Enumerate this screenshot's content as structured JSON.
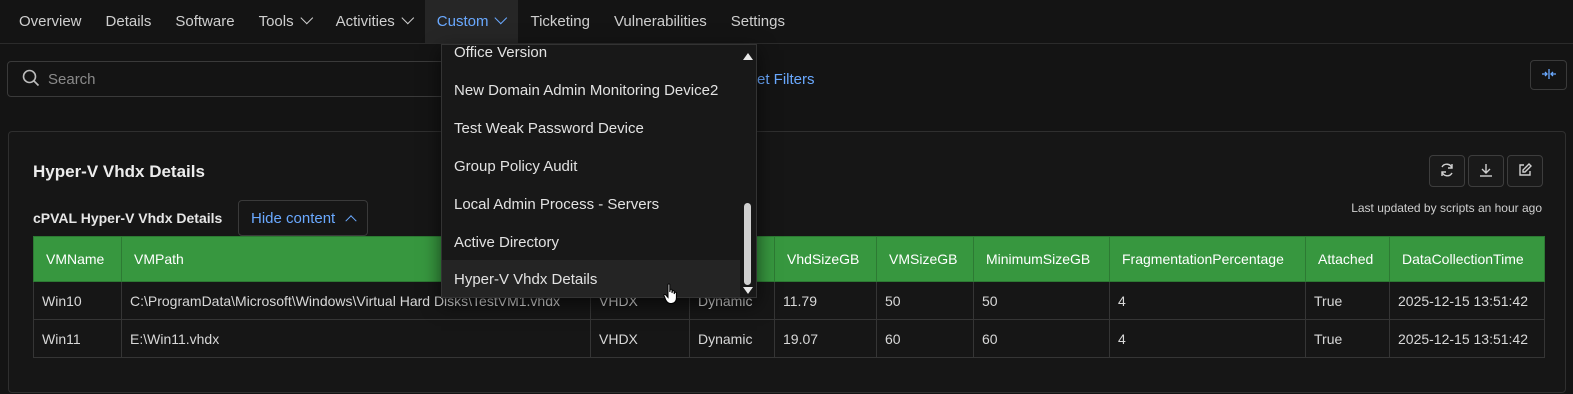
{
  "nav": {
    "items": [
      {
        "label": "Overview",
        "has_menu": false,
        "active": false
      },
      {
        "label": "Details",
        "has_menu": false,
        "active": false
      },
      {
        "label": "Software",
        "has_menu": false,
        "active": false
      },
      {
        "label": "Tools",
        "has_menu": true,
        "active": false
      },
      {
        "label": "Activities",
        "has_menu": true,
        "active": false
      },
      {
        "label": "Custom",
        "has_menu": true,
        "active": true
      },
      {
        "label": "Ticketing",
        "has_menu": false,
        "active": false
      },
      {
        "label": "Vulnerabilities",
        "has_menu": false,
        "active": false
      },
      {
        "label": "Settings",
        "has_menu": false,
        "active": false
      }
    ]
  },
  "search": {
    "placeholder": "Search",
    "value": ""
  },
  "filters": {
    "reset_label": "et Filters"
  },
  "dropdown": {
    "items": [
      "Office Version",
      "New Domain Admin Monitoring Device2",
      "Test Weak Password Device",
      "Group Policy Audit",
      "Local Admin Process - Servers",
      "Active Directory",
      "Hyper-V Vhdx Details"
    ],
    "hovered_index": 6
  },
  "panel": {
    "title": "Hyper-V Vhdx Details",
    "subtitle": "cPVAL Hyper-V Vhdx Details",
    "hide_label": "Hide content",
    "updated": "Last updated by scripts an hour ago",
    "tools": [
      "refresh-icon",
      "download-icon",
      "edit-icon"
    ]
  },
  "table": {
    "columns": [
      "VMName",
      "VMPath",
      "",
      "",
      "VhdSizeGB",
      "VMSizeGB",
      "MinimumSizeGB",
      "FragmentationPercentage",
      "Attached",
      "DataCollectionTime"
    ],
    "rows": [
      [
        "Win10",
        "C:\\ProgramData\\Microsoft\\Windows\\Virtual Hard Disks\\TestVM1.vhdx",
        "VHDX",
        "Dynamic",
        "11.79",
        "50",
        "50",
        "4",
        "True",
        "2025-12-15 13:51:42"
      ],
      [
        "Win11",
        "E:\\Win11.vhdx",
        "VHDX",
        "Dynamic",
        "19.07",
        "60",
        "60",
        "4",
        "True",
        "2025-12-15 13:51:42"
      ]
    ]
  },
  "colors": {
    "accent": "#6aa9ff",
    "header_green": "#37973f",
    "background": "#141414"
  }
}
